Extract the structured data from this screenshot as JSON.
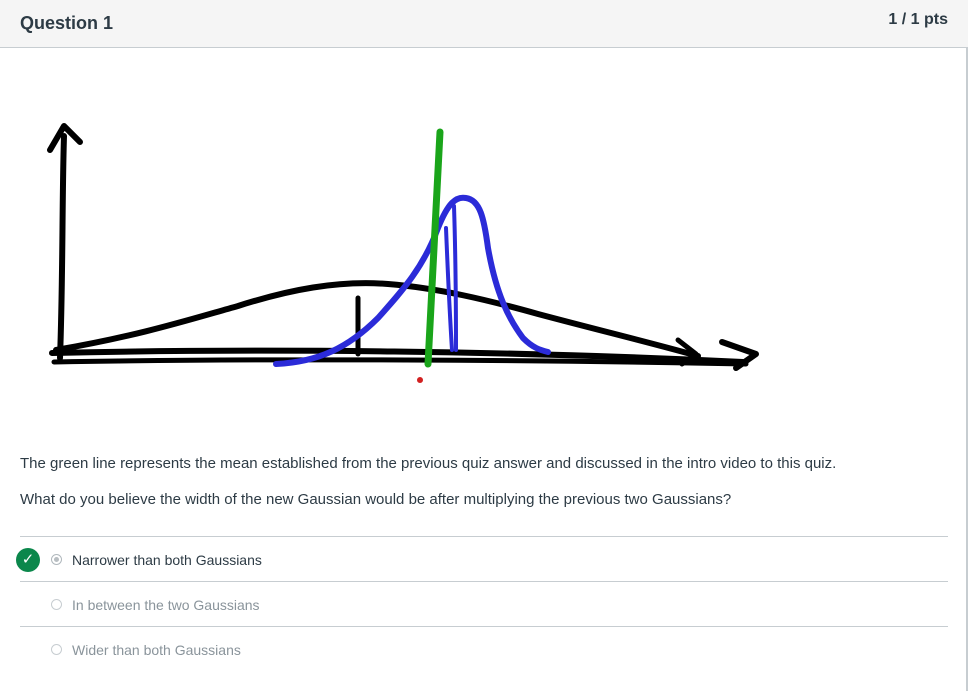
{
  "question": {
    "title": "Question 1",
    "points": "1 / 1 pts",
    "text_line1": "The green line represents the mean established from the previous quiz answer and discussed in the intro video to this quiz.",
    "text_line2": "What do you believe the width of the new Gaussian would be after multiplying the previous two Gaussians?"
  },
  "figure": {
    "curve_colors": {
      "axes_and_wide_gaussian": "#000000",
      "narrow_gaussian": "#2b2bd8",
      "mean_line": "#1aa51a"
    }
  },
  "answers": [
    {
      "label": "Narrower than both Gaussians",
      "selected": true,
      "correct": true
    },
    {
      "label": "In between the two Gaussians",
      "selected": false,
      "correct": false
    },
    {
      "label": "Wider than both Gaussians",
      "selected": false,
      "correct": false
    }
  ],
  "colors": {
    "correct_badge": "#0b874b",
    "header_bg": "#f5f5f5",
    "divider": "#c7cdd1"
  }
}
